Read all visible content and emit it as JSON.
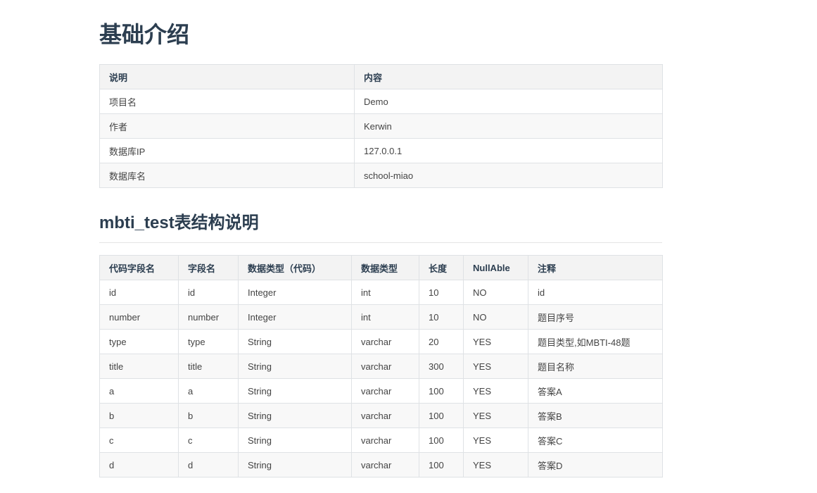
{
  "page_title": "基础介绍",
  "intro_table": {
    "headers": [
      "说明",
      "内容"
    ],
    "rows": [
      [
        "项目名",
        "Demo"
      ],
      [
        "作者",
        "Kerwin"
      ],
      [
        "数据库IP",
        "127.0.0.1"
      ],
      [
        "数据库名",
        "school-miao"
      ]
    ]
  },
  "section_title": "mbti_test表结构说明",
  "structure_table": {
    "headers": [
      "代码字段名",
      "字段名",
      "数据类型（代码）",
      "数据类型",
      "长度",
      "NullAble",
      "注释"
    ],
    "rows": [
      [
        "id",
        "id",
        "Integer",
        "int",
        "10",
        "NO",
        "id"
      ],
      [
        "number",
        "number",
        "Integer",
        "int",
        "10",
        "NO",
        "题目序号"
      ],
      [
        "type",
        "type",
        "String",
        "varchar",
        "20",
        "YES",
        "题目类型,如MBTI-48题"
      ],
      [
        "title",
        "title",
        "String",
        "varchar",
        "300",
        "YES",
        "题目名称"
      ],
      [
        "a",
        "a",
        "String",
        "varchar",
        "100",
        "YES",
        "答案A"
      ],
      [
        "b",
        "b",
        "String",
        "varchar",
        "100",
        "YES",
        "答案B"
      ],
      [
        "c",
        "c",
        "String",
        "varchar",
        "100",
        "YES",
        "答案C"
      ],
      [
        "d",
        "d",
        "String",
        "varchar",
        "100",
        "YES",
        "答案D"
      ]
    ]
  }
}
